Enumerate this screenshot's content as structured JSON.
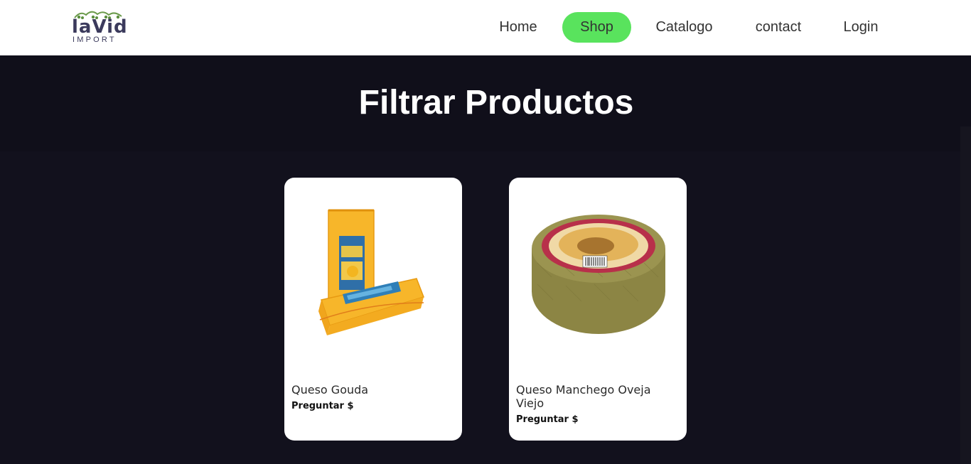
{
  "brand": {
    "word": "laVid",
    "sub": "IMPORT"
  },
  "nav": {
    "home": "Home",
    "shop": "Shop",
    "catalogo": "Catalogo",
    "contact": "contact",
    "login": "Login",
    "active": "Shop",
    "active_color": "#59e35d"
  },
  "page": {
    "title": "Filtrar Productos"
  },
  "products": [
    {
      "name": "Queso Gouda",
      "price": "Preguntar $",
      "image": "gouda-cheese-blocks"
    },
    {
      "name": "Queso Manchego Oveja Viejo",
      "price": "Preguntar $",
      "image": "manchego-cheese-wheel"
    }
  ]
}
